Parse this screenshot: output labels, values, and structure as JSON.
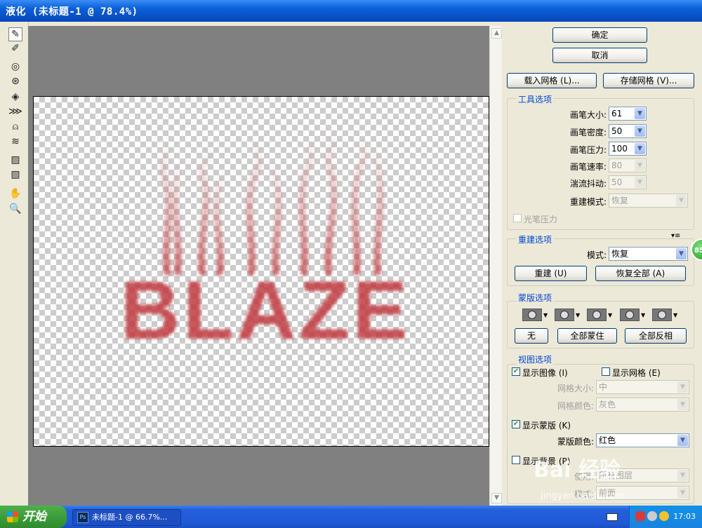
{
  "window": {
    "title": "液化 (未标题-1 @ 78.4%)"
  },
  "canvas": {
    "text": "BLAZE",
    "text_color": "#c0393e"
  },
  "tools": [
    "warp-icon",
    "reconstruct-icon",
    "twirl-icon",
    "pucker-icon",
    "bloat-icon",
    "push-left-icon",
    "mirror-icon",
    "turbulence-icon",
    "freeze-mask-icon",
    "thaw-mask-icon",
    "hand-icon",
    "zoom-icon"
  ],
  "buttons": {
    "ok": "确定",
    "cancel": "取消",
    "load_mesh": "载入网格 (L)...",
    "save_mesh": "存储网格 (V)..."
  },
  "tool_options": {
    "title": "工具选项",
    "brush_size": {
      "label": "画笔大小:",
      "value": "61"
    },
    "brush_density": {
      "label": "画笔密度:",
      "value": "50"
    },
    "brush_pressure": {
      "label": "画笔压力:",
      "value": "100"
    },
    "brush_rate": {
      "label": "画笔速率:",
      "value": "80"
    },
    "turbulent_jitter": {
      "label": "湍流抖动:",
      "value": "50"
    },
    "reconstruct_mode": {
      "label": "重建模式:",
      "value": "恢复"
    },
    "stylus_pressure": "光笔压力"
  },
  "reconstruct_options": {
    "title": "重建选项",
    "mode_label": "模式:",
    "mode_value": "恢复",
    "reconstruct_btn": "重建 (U)",
    "restore_all_btn": "恢复全部 (A)"
  },
  "mask_options": {
    "title": "蒙版选项",
    "none_btn": "无",
    "mask_all_btn": "全部蒙住",
    "invert_all_btn": "全部反相"
  },
  "view_options": {
    "title": "视图选项",
    "show_image": "显示图像 (I)",
    "show_mesh": "显示网格 (E)",
    "mesh_size_label": "网格大小:",
    "mesh_size_value": "中",
    "mesh_color_label": "网格颜色:",
    "mesh_color_value": "灰色",
    "show_mask": "显示蒙版 (K)",
    "mask_color_label": "蒙版颜色:",
    "mask_color_value": "红色",
    "show_backdrop": "显示背景 (P)",
    "use_label": "使用:",
    "use_value": "所有图层",
    "mode_label": "模式:",
    "mode_value": "前面"
  },
  "side_badge": "85",
  "watermark": {
    "main": "Bai 经验",
    "url": "jingyan.baidu.com"
  },
  "taskbar": {
    "start_label": "开始",
    "task_label": "未标题-1 @ 66.7%...",
    "task_icon": "Ps",
    "clock": "17:03"
  }
}
